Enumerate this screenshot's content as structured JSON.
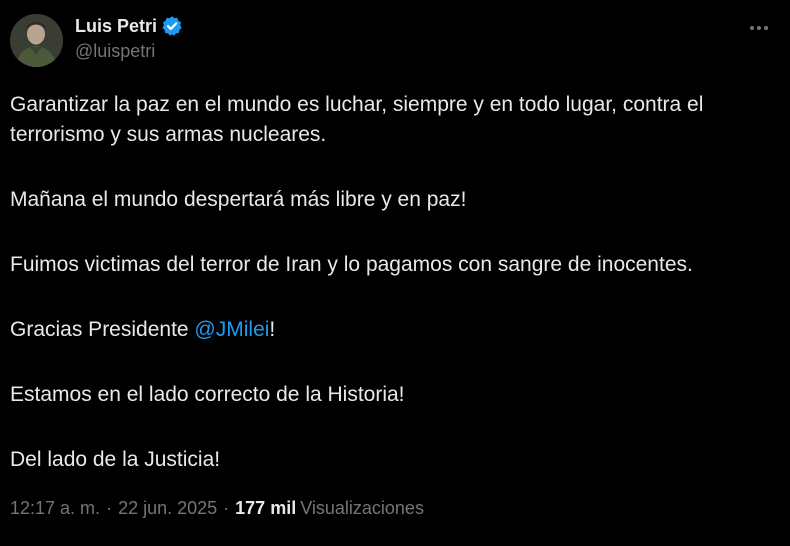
{
  "author": {
    "display_name": "Luis Petri",
    "handle": "@luispetri",
    "verified_icon": "verified-badge-icon",
    "verified_color": "#1d9bf0"
  },
  "tweet": {
    "paragraphs": [
      "Garantizar la paz en el mundo es luchar, siempre y en todo lugar, contra el terrorismo y sus armas nucleares.",
      "Mañana el mundo despertará más libre y en paz!",
      "Fuimos victimas del terror de Iran y lo pagamos con sangre de inocentes."
    ],
    "thanks_prefix": "Gracias Presidente ",
    "mention": "@JMilei",
    "thanks_suffix": "!",
    "closing": [
      "Estamos en el lado correcto de la Historia!",
      "Del lado de la Justicia!"
    ]
  },
  "meta": {
    "time": "12:17 a. m.",
    "separator": "·",
    "date": "22 jun. 2025",
    "views_count": "177 mil",
    "views_label": "Visualizaciones"
  },
  "colors": {
    "background": "#000000",
    "text": "#e7e9ea",
    "muted": "#71767b",
    "link": "#1d9bf0"
  },
  "icons": {
    "more": "more-options-icon"
  }
}
